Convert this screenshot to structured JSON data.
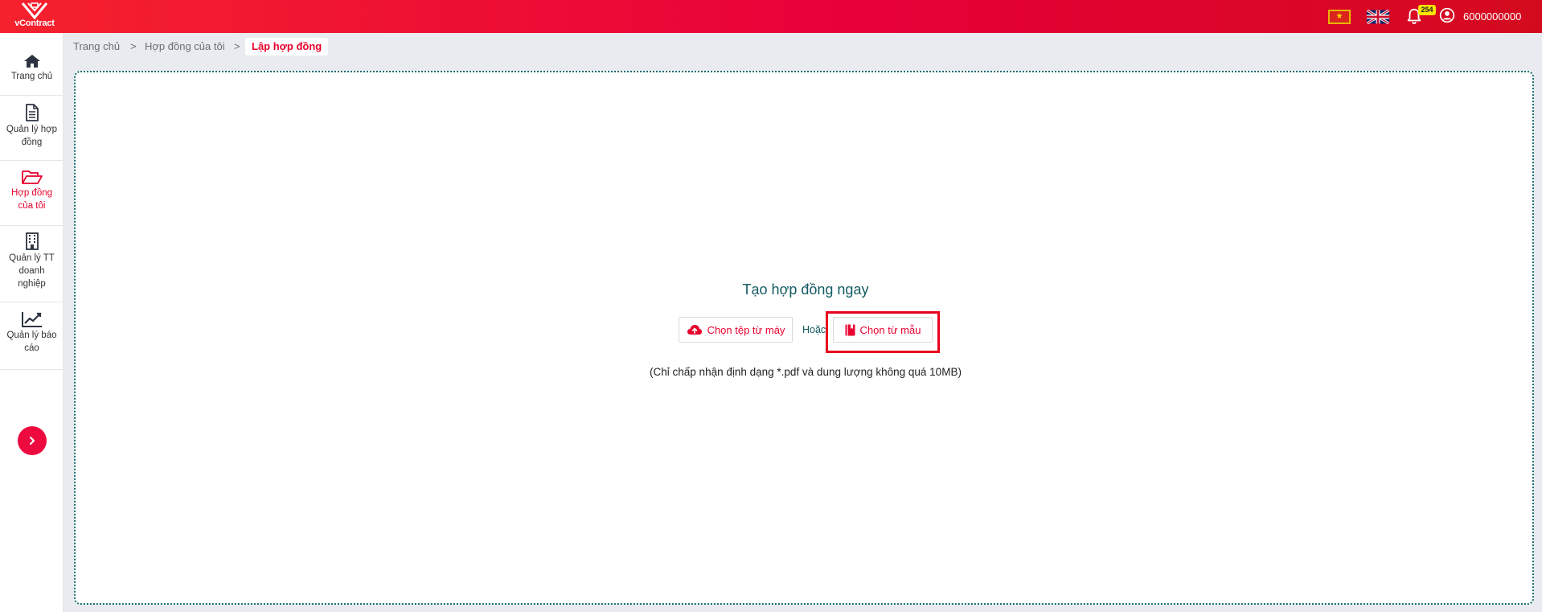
{
  "header": {
    "logo_text": "vContract",
    "notification_count": "254",
    "user_name": "6000000000",
    "icons": [
      "vietnam-flag-icon",
      "uk-flag-icon",
      "bell-icon",
      "user-circle-icon"
    ]
  },
  "sidebar": {
    "items": [
      {
        "label": "Trang chủ",
        "icon": "home-icon"
      },
      {
        "label": "Quản lý hợp đồng",
        "icon": "document-icon"
      },
      {
        "label": "Hợp đồng của tôi",
        "icon": "folder-open-icon",
        "active": true
      },
      {
        "label": "Quản lý TT doanh nghiệp",
        "icon": "building-icon"
      },
      {
        "label": "Quản lý báo cáo",
        "icon": "chart-line-icon"
      }
    ],
    "expand_icon": "chevron-right-icon"
  },
  "breadcrumb": {
    "items": [
      "Trang chủ",
      "Hợp đồng của tôi",
      "Lập hợp đồng"
    ],
    "separator": ">"
  },
  "main": {
    "title": "Tạo hợp đồng ngay",
    "upload_button": "Chọn tệp từ máy",
    "or_text": "Hoặc",
    "template_button": "Chọn từ mẫu",
    "note": "(Chỉ chấp nhận định dạng *.pdf và dung lượng không quá 10MB)"
  },
  "colors": {
    "accent": "#e8002d",
    "header_start": "#f5222d",
    "header_end": "#d30a1e",
    "teal_text": "#135a61",
    "border_dotted": "#0d6a6d",
    "highlight": "#e8001d"
  }
}
